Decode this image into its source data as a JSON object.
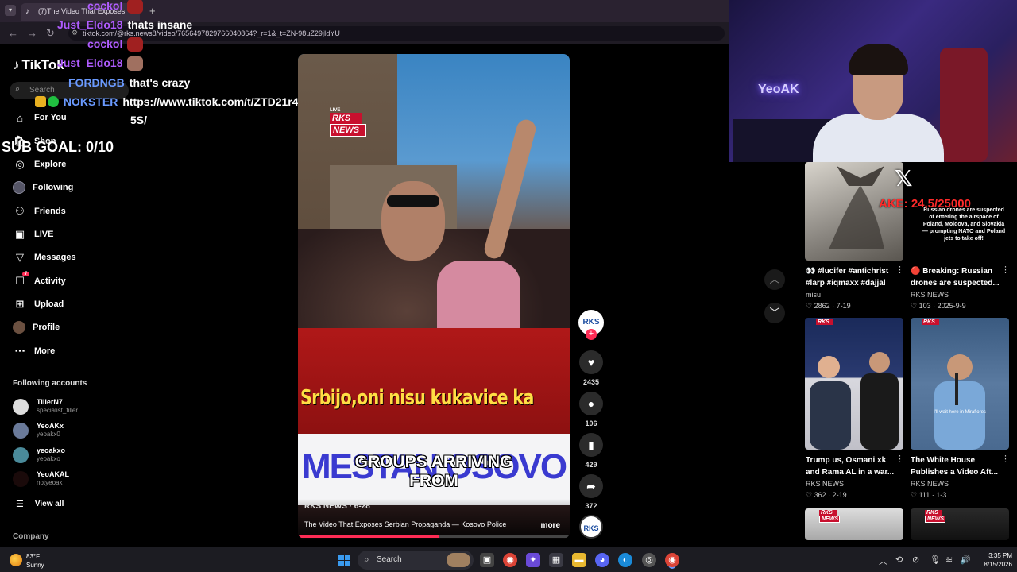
{
  "browser": {
    "tab_title": "(7)The Video That Exposes",
    "url": "tiktok.com/@rks.news8/video/7656497829766040864?_r=1&_t=ZN-98uZ29jIdYU"
  },
  "sidebar": {
    "logo": "TikTok",
    "search_placeholder": "Search",
    "items": [
      {
        "label": "For You",
        "icon": "home-icon"
      },
      {
        "label": "Shop",
        "icon": "shop-icon"
      },
      {
        "label": "Explore",
        "icon": "compass-icon"
      },
      {
        "label": "Following",
        "icon": "following-avatar"
      },
      {
        "label": "Friends",
        "icon": "friends-icon"
      },
      {
        "label": "LIVE",
        "icon": "live-icon"
      },
      {
        "label": "Messages",
        "icon": "messages-icon"
      },
      {
        "label": "Activity",
        "icon": "activity-icon",
        "badge": "7"
      },
      {
        "label": "Upload",
        "icon": "upload-icon"
      },
      {
        "label": "Profile",
        "icon": "profile-avatar"
      },
      {
        "label": "More",
        "icon": "more-icon"
      }
    ],
    "following_title": "Following accounts",
    "accounts": [
      {
        "name": "TillerN7",
        "handle": "specialist_tiller"
      },
      {
        "name": "YeoAKx",
        "handle": "yeoakx0"
      },
      {
        "name": "yeoakxo",
        "handle": "yeoakxo"
      },
      {
        "name": "YeoAKAL",
        "handle": "notyeoak"
      }
    ],
    "view_all": "View all",
    "company": "Company"
  },
  "chat": {
    "messages": [
      {
        "user": "cockol",
        "text": "",
        "color": "#b05cff"
      },
      {
        "user": "Just_Eldo18",
        "text": "thats insane",
        "color": "#b05cff"
      },
      {
        "user": "cockol",
        "text": "",
        "color": "#b05cff"
      },
      {
        "user": "Just_Eldo18",
        "text": "",
        "color": "#b05cff"
      },
      {
        "user": "FORDNGB",
        "text": "that's crazy",
        "color": "#6a9aff"
      },
      {
        "user": "NOKSTER",
        "text": "https://www.tiktok.com/t/ZTD21r4",
        "color": "#6a9aff"
      }
    ],
    "continuation": "5S/",
    "sub_goal": "SUB GOAL: 0/10"
  },
  "video": {
    "live_tag": "LIVE",
    "logo_top": "RKS",
    "logo_bottom": "NEWS",
    "caption_red": "Srbijo,oni nisu kukavice ka",
    "banner": "MESTAN  OSOVO",
    "caption_line1": "GROUPS ARRIVING",
    "caption_line2": "FROM",
    "author": "RKS NEWS · 6-28",
    "description": "The Video That Exposes Serbian Propaganda — Kosovo Police",
    "more": "more",
    "progress": 0.52
  },
  "actions": {
    "avatar": "RKS",
    "likes": "2435",
    "comments": "106",
    "saves": "429",
    "shares": "372"
  },
  "webcam": {
    "neon": "YeoAK"
  },
  "overlay": {
    "goal": "AKE: 24,5",
    "goal_rest": "/25000"
  },
  "recommendations": [
    {
      "title": "👀 #lucifer #antichrist #larp #iqmaxx #dajjal",
      "author": "misu",
      "likes": "2862",
      "date": "7-19"
    },
    {
      "title": "🔴 Breaking: Russian drones are suspected...",
      "author": "RKS NEWS",
      "likes": "103",
      "date": "2025-9-9"
    },
    {
      "title": "Trump us, Osmani xk and Rama AL in a war...",
      "author": "RKS NEWS",
      "likes": "362",
      "date": "2-19"
    },
    {
      "title": "The White House Publishes a Video Aft...",
      "author": "RKS NEWS",
      "likes": "111",
      "date": "1-3"
    }
  ],
  "rec_thumb_text": "Russian drones are suspected of entering the airspace of Poland, Moldova, and Slovakia — prompting NATO and Poland jets to take off!",
  "rec_thumb_caption": "I'll wait here in Miraflores",
  "rks_mini_top": "RKS",
  "rks_mini_bottom": "NEWS",
  "taskbar": {
    "temp": "83°F",
    "weather": "Sunny",
    "search": "Search",
    "time": "3:35 PM",
    "date": "8/15/2026"
  }
}
